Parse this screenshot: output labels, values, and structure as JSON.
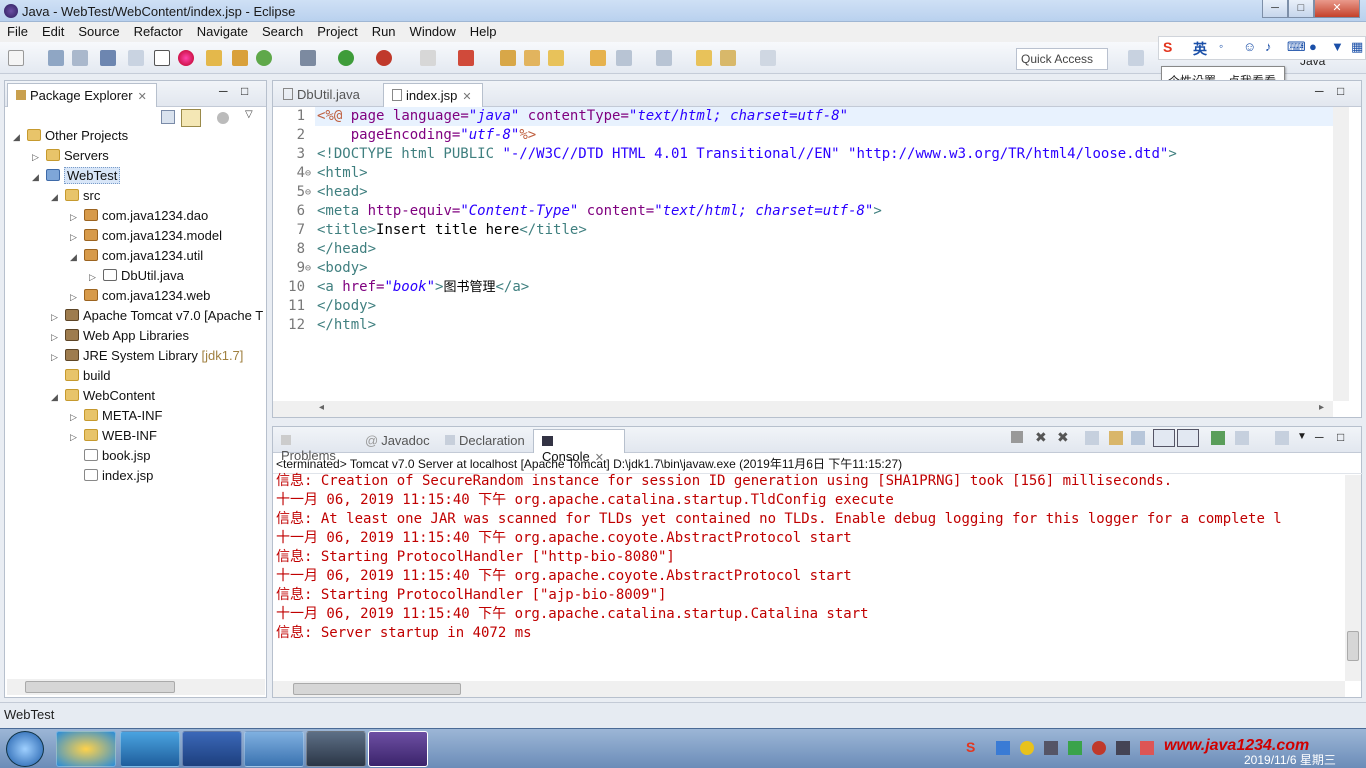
{
  "window": {
    "title": "Java - WebTest/WebContent/index.jsp - Eclipse",
    "min": "─",
    "max": "□",
    "close": "✕"
  },
  "menu": [
    "File",
    "Edit",
    "Source",
    "Refactor",
    "Navigate",
    "Search",
    "Project",
    "Run",
    "Window",
    "Help"
  ],
  "quick_access": "Quick Access",
  "ime": {
    "brand": "S",
    "lang": "英",
    "tooltip": "个性设置，点我看看"
  },
  "perspectives": [
    "Java",
    "Java"
  ],
  "package_explorer": {
    "title": "Package Explorer",
    "tree": [
      {
        "label": "Other Projects",
        "level": 0,
        "icon": "folder-icon",
        "twisty": "◢"
      },
      {
        "label": "Servers",
        "level": 1,
        "icon": "folder-icon",
        "twisty": "▷"
      },
      {
        "label": "WebTest",
        "level": 1,
        "icon": "project-icon",
        "twisty": "◢",
        "selected": true
      },
      {
        "label": "src",
        "level": 2,
        "icon": "folder-icon",
        "twisty": "◢"
      },
      {
        "label": "com.java1234.dao",
        "level": 3,
        "icon": "package-icon",
        "twisty": "▷"
      },
      {
        "label": "com.java1234.model",
        "level": 3,
        "icon": "package-icon",
        "twisty": "▷"
      },
      {
        "label": "com.java1234.util",
        "level": 3,
        "icon": "package-icon",
        "twisty": "◢"
      },
      {
        "label": "DbUtil.java",
        "level": 4,
        "icon": "java-file-icon",
        "twisty": "▷"
      },
      {
        "label": "com.java1234.web",
        "level": 3,
        "icon": "package-icon",
        "twisty": "▷"
      },
      {
        "label": "Apache Tomcat v7.0 [Apache T",
        "level": 2,
        "icon": "library-icon",
        "twisty": "▷"
      },
      {
        "label": "Web App Libraries",
        "level": 2,
        "icon": "library-icon",
        "twisty": "▷"
      },
      {
        "label": "JRE System Library",
        "suffix": "[jdk1.7]",
        "level": 2,
        "icon": "library-icon",
        "twisty": "▷"
      },
      {
        "label": "build",
        "level": 2,
        "icon": "folder-icon",
        "twisty": ""
      },
      {
        "label": "WebContent",
        "level": 2,
        "icon": "folder-icon",
        "twisty": "◢"
      },
      {
        "label": "META-INF",
        "level": 3,
        "icon": "folder-icon",
        "twisty": "▷"
      },
      {
        "label": "WEB-INF",
        "level": 3,
        "icon": "folder-icon",
        "twisty": "▷"
      },
      {
        "label": "book.jsp",
        "level": 3,
        "icon": "jsp-file-icon",
        "twisty": ""
      },
      {
        "label": "index.jsp",
        "level": 3,
        "icon": "jsp-file-icon",
        "twisty": ""
      }
    ]
  },
  "editor": {
    "tabs": [
      {
        "label": "DbUtil.java",
        "active": false
      },
      {
        "label": "index.jsp",
        "active": true
      }
    ],
    "line_numbers": [
      "1",
      "2",
      "3",
      "4",
      "5",
      "6",
      "7",
      "8",
      "9",
      "10",
      "11",
      "12"
    ],
    "fold_markers": {
      "4": "⊖",
      "5": "⊖",
      "9": "⊖"
    }
  },
  "bottom_tabs": [
    {
      "label": "Problems",
      "active": false
    },
    {
      "label": "Javadoc",
      "active": false
    },
    {
      "label": "Declaration",
      "active": false
    },
    {
      "label": "Console",
      "active": true
    }
  ],
  "console": {
    "header": "<terminated> Tomcat v7.0 Server at localhost [Apache Tomcat] D:\\jdk1.7\\bin\\javaw.exe (2019年11月6日 下午11:15:27)",
    "lines": [
      "信息: Creation of SecureRandom instance for session ID generation using [SHA1PRNG] took [156] milliseconds.",
      "十一月 06, 2019 11:15:40 下午 org.apache.catalina.startup.TldConfig execute",
      "信息: At least one JAR was scanned for TLDs yet contained no TLDs. Enable debug logging for this logger for a complete l",
      "十一月 06, 2019 11:15:40 下午 org.apache.coyote.AbstractProtocol start",
      "信息: Starting ProtocolHandler [\"http-bio-8080\"]",
      "十一月 06, 2019 11:15:40 下午 org.apache.coyote.AbstractProtocol start",
      "信息: Starting ProtocolHandler [\"ajp-bio-8009\"]",
      "十一月 06, 2019 11:15:40 下午 org.apache.catalina.startup.Catalina start",
      "信息: Server startup in 4072 ms"
    ]
  },
  "status_bar": {
    "left": "WebTest"
  },
  "taskbar": {
    "clock_date": "2019/11/6 星期三",
    "watermark": "www.java1234.com"
  }
}
